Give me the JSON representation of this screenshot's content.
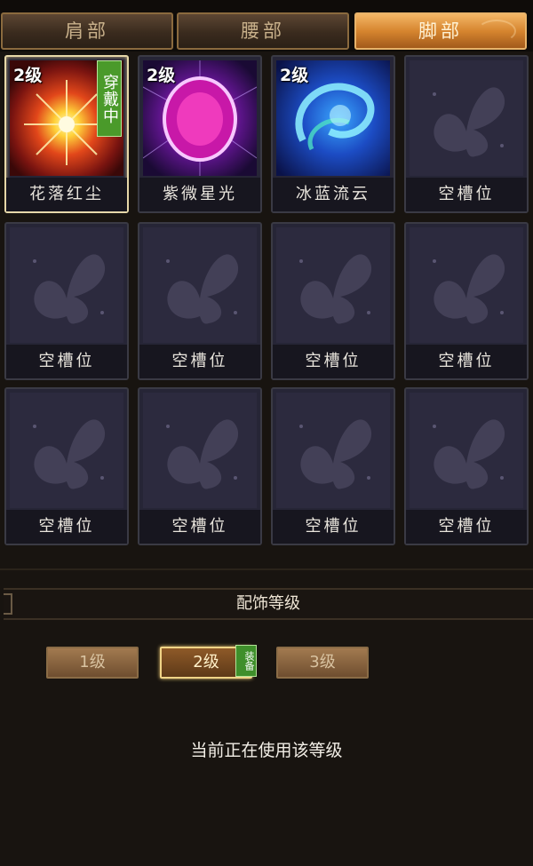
{
  "tabs": [
    {
      "label": "肩部",
      "active": false
    },
    {
      "label": "腰部",
      "active": false
    },
    {
      "label": "脚部",
      "active": true
    }
  ],
  "slots": [
    {
      "name": "花落红尘",
      "level": "2级",
      "badge": "穿戴中",
      "art": "red-burst-icon"
    },
    {
      "name": "紫微星光",
      "level": "2级",
      "badge": "",
      "art": "purple-orb-icon"
    },
    {
      "name": "冰蓝流云",
      "level": "2级",
      "badge": "",
      "art": "blue-swirl-icon"
    },
    {
      "name": "空槽位"
    },
    {
      "name": "空槽位"
    },
    {
      "name": "空槽位"
    },
    {
      "name": "空槽位"
    },
    {
      "name": "空槽位"
    },
    {
      "name": "空槽位"
    },
    {
      "name": "空槽位"
    },
    {
      "name": "空槽位"
    },
    {
      "name": "空槽位"
    }
  ],
  "level_panel": {
    "title": "配饰等级",
    "buttons": [
      "1级",
      "2级",
      "3级"
    ],
    "active_level": "2级",
    "equip_badge": "装备",
    "status": "当前正在使用该等级"
  },
  "colors": {
    "tab_active": "#d6852f",
    "badge_green": "#4a9a2a",
    "slot_bg": "#262536"
  }
}
